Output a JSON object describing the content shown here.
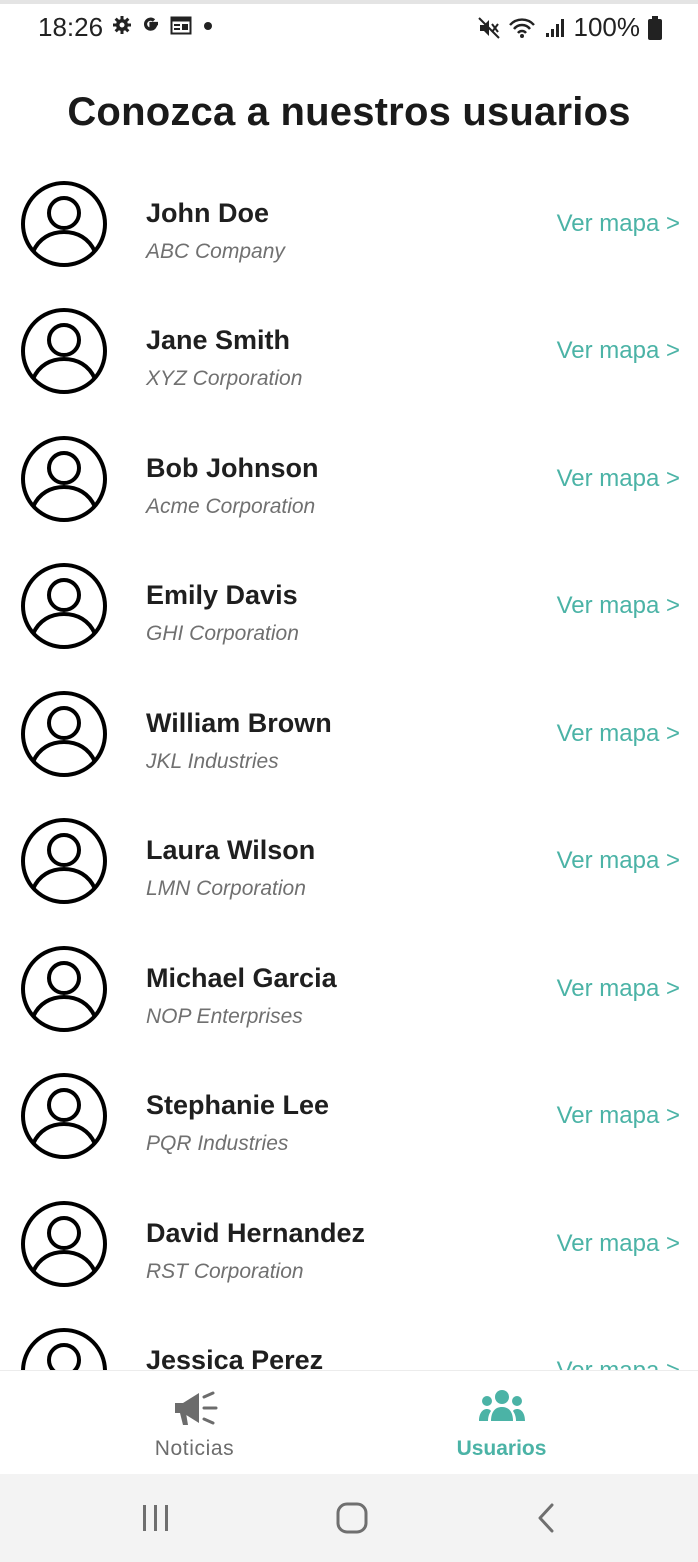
{
  "status_bar": {
    "time": "18:26",
    "left_icons": [
      "gear-icon",
      "google-g-icon",
      "calendar-icon",
      "dot-icon"
    ],
    "right_icons": [
      "mute-icon",
      "wifi-icon",
      "signal-icon",
      "battery-icon"
    ],
    "battery": "100%"
  },
  "page": {
    "title": "Conozca a nuestros usuarios"
  },
  "users": [
    {
      "name": "John Doe",
      "company": "ABC Company",
      "link": "Ver mapa >"
    },
    {
      "name": "Jane Smith",
      "company": "XYZ Corporation",
      "link": "Ver mapa >"
    },
    {
      "name": "Bob Johnson",
      "company": "Acme Corporation",
      "link": "Ver mapa >"
    },
    {
      "name": "Emily Davis",
      "company": "GHI Corporation",
      "link": "Ver mapa >"
    },
    {
      "name": "William Brown",
      "company": "JKL Industries",
      "link": "Ver mapa >"
    },
    {
      "name": "Laura Wilson",
      "company": "LMN Corporation",
      "link": "Ver mapa >"
    },
    {
      "name": "Michael Garcia",
      "company": "NOP Enterprises",
      "link": "Ver mapa >"
    },
    {
      "name": "Stephanie Lee",
      "company": "PQR Industries",
      "link": "Ver mapa >"
    },
    {
      "name": "David Hernandez",
      "company": "RST Corporation",
      "link": "Ver mapa >"
    },
    {
      "name": "Jessica Perez",
      "company": "",
      "link": "Ver mapa >"
    }
  ],
  "tabs": [
    {
      "label": "Noticias",
      "icon": "megaphone-icon",
      "active": false
    },
    {
      "label": "Usuarios",
      "icon": "users-icon",
      "active": true
    }
  ],
  "colors": {
    "accent": "#4bb3a6",
    "inactive_tab": "#6c6c6c",
    "text": "#1a1a1a",
    "subtext": "#707070"
  },
  "system_nav": [
    "recent-apps-icon",
    "home-icon",
    "back-icon"
  ]
}
